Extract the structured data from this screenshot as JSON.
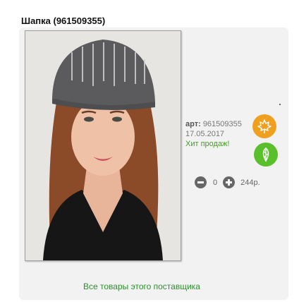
{
  "product": {
    "title": "Шапка (961509355)",
    "article_label": "арт:",
    "article_value": "961509355",
    "date": "17.05.2017",
    "badge": "Хит продаж!"
  },
  "cart": {
    "quantity": "0",
    "price": "244р."
  },
  "footer": {
    "supplier_link": "Все товары этого поставщика"
  },
  "icons": {
    "orange_leaf": "maple-leaf-icon",
    "green_leaf": "leaf-icon",
    "minus": "minus-icon",
    "plus": "plus-icon"
  },
  "colors": {
    "orange_badge": "#f0a020",
    "green_badge": "#59c02b",
    "link": "#2f8f2f",
    "hit_text": "#3f9f1f"
  }
}
